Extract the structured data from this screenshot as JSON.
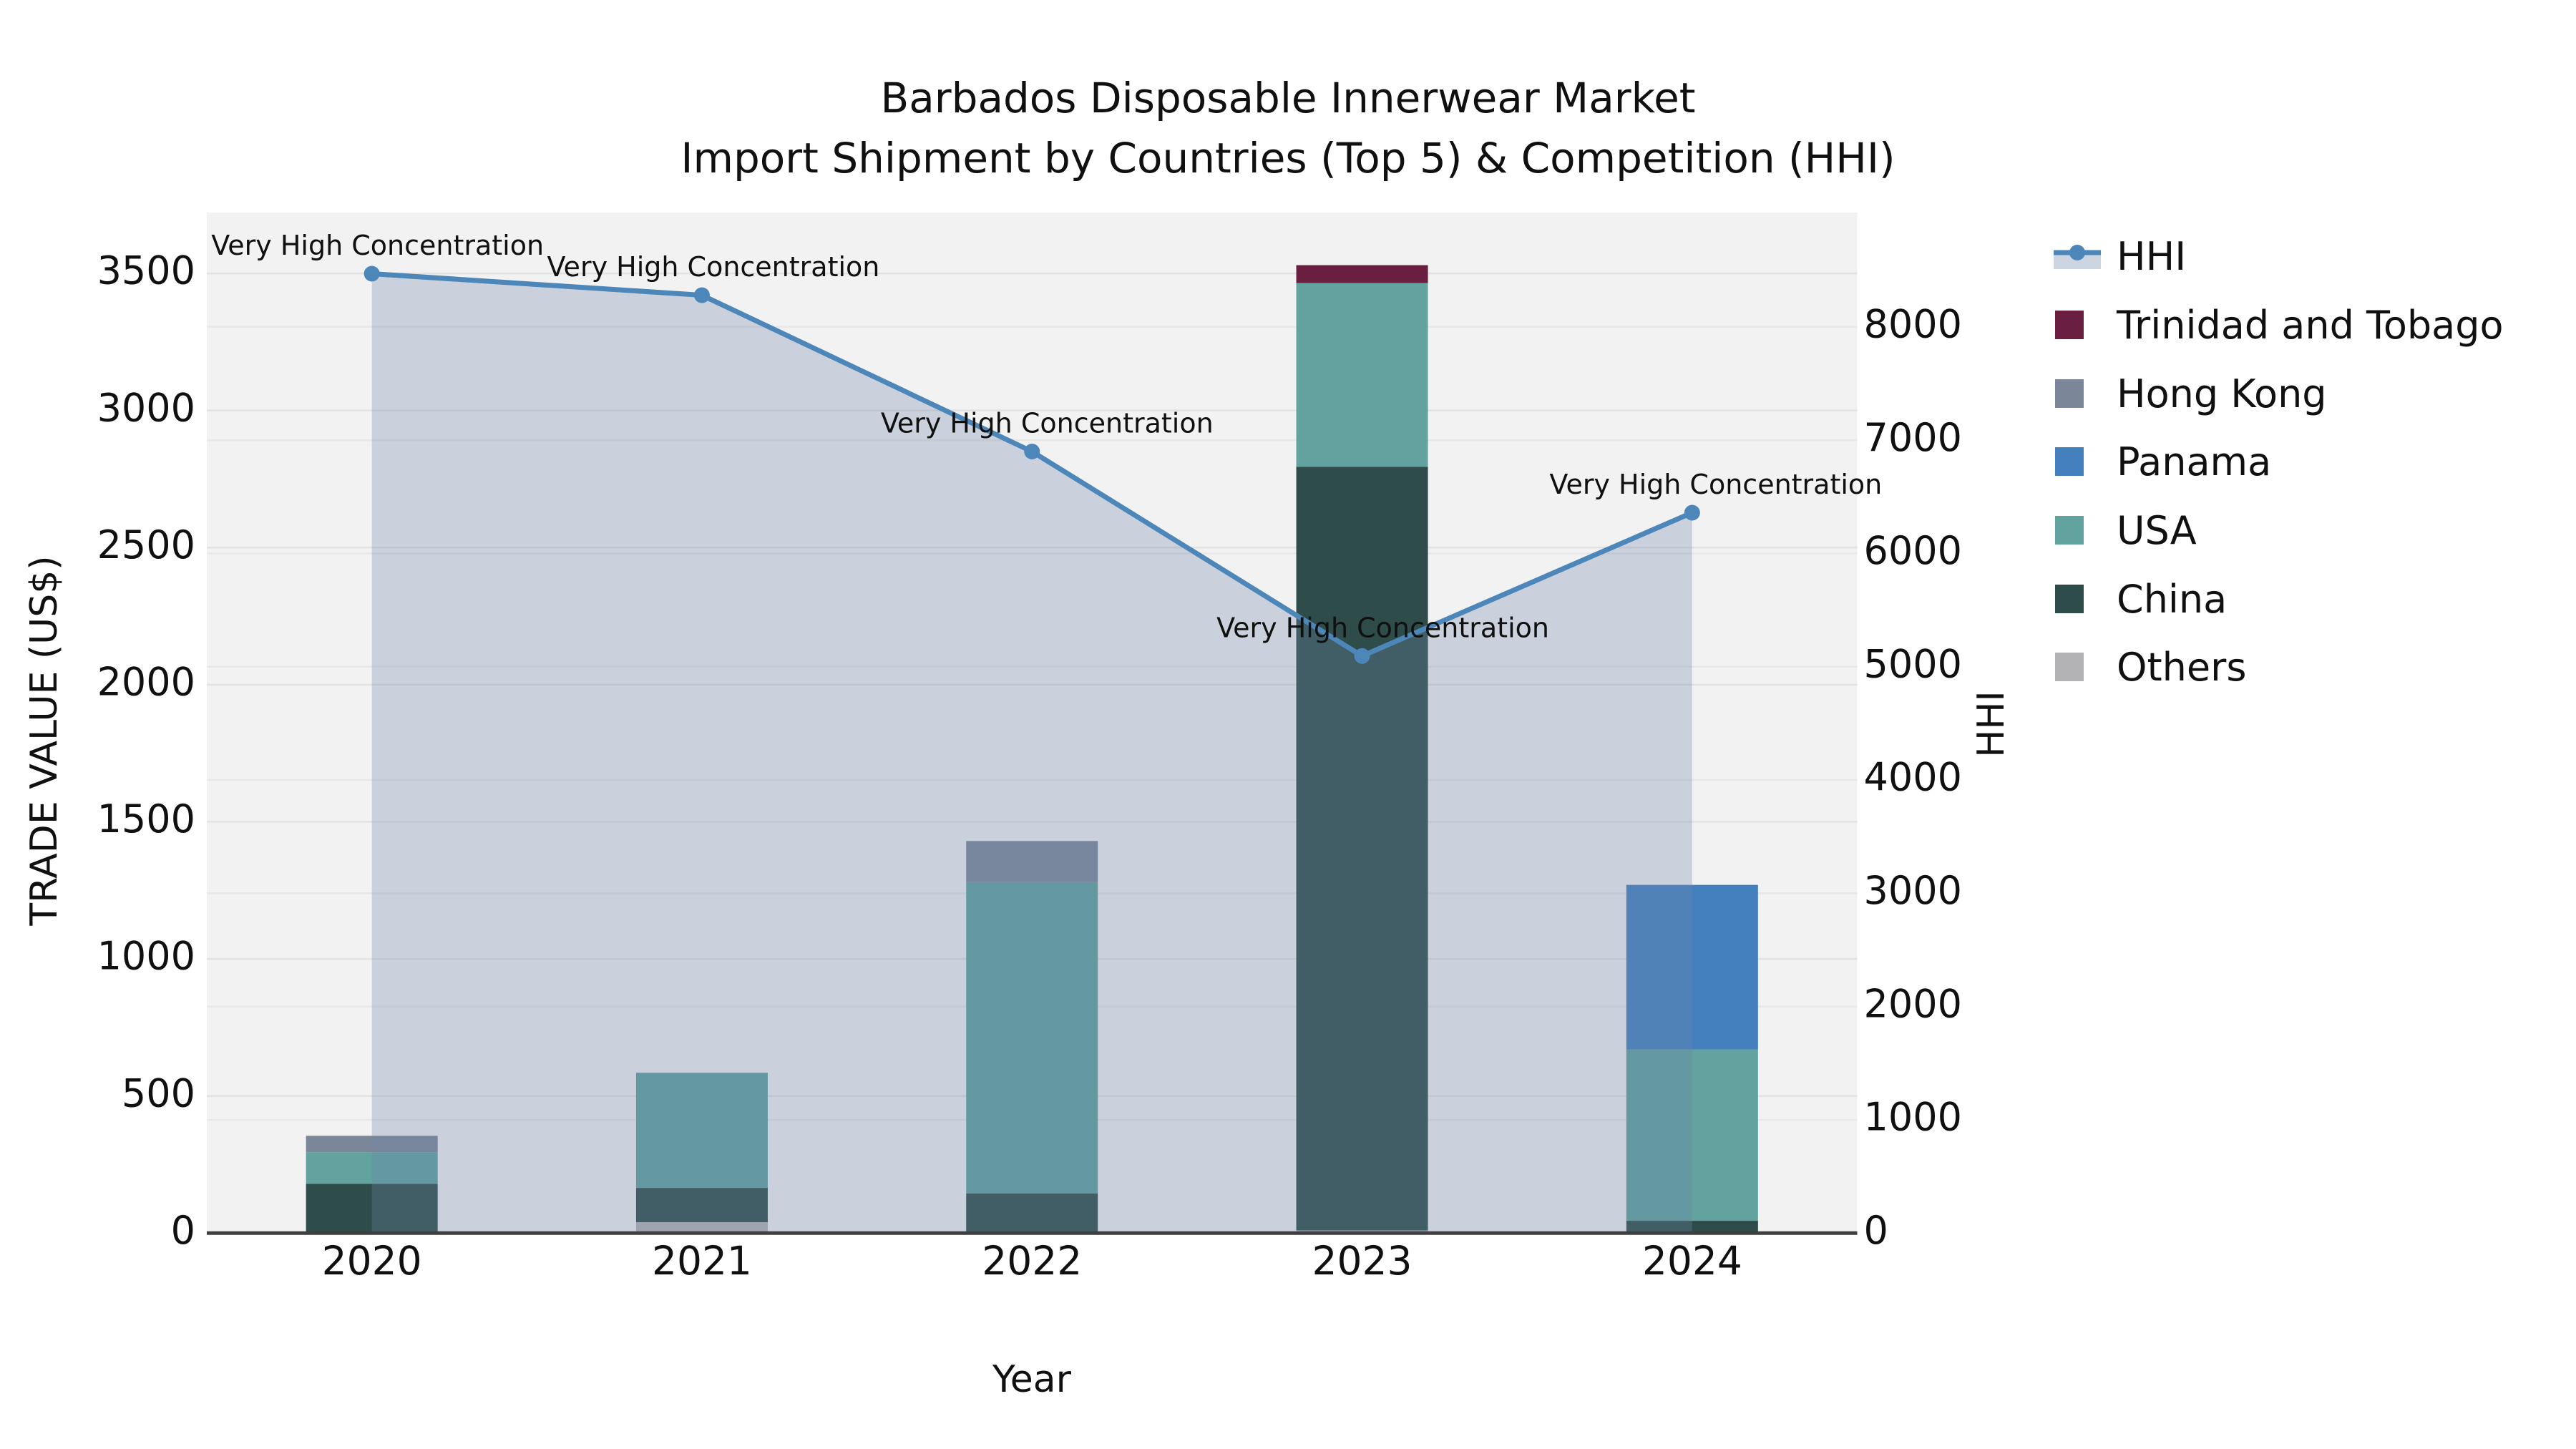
{
  "title": {
    "line1": "Barbados Disposable Innerwear Market",
    "line2": "Import Shipment by Countries (Top 5) & Competition (HHI)"
  },
  "colors": {
    "plot_background": "#f2f2f2",
    "grid_left": "#e2e2e2",
    "grid_right": "#e7e7e7",
    "axis_line": "#3f3f3f",
    "hhi_line": "#4d86b8",
    "hhi_area_fill": "rgba(109,132,169,0.30)",
    "hhi_legend_band": "#ccd5e0",
    "text": "#101010"
  },
  "chart_data": {
    "type": "combo-stacked-bar-line",
    "title": "Barbados Disposable Innerwear Market — Import Shipment by Countries (Top 5) & Competition (HHI)",
    "categories": [
      "2020",
      "2021",
      "2022",
      "2023",
      "2024"
    ],
    "bar_series": [
      {
        "name": "Others",
        "color": "#b3b3b5",
        "values": [
          0,
          40,
          0,
          10,
          0
        ]
      },
      {
        "name": "China",
        "color": "#2e4c49",
        "values": [
          180,
          125,
          145,
          2785,
          45
        ]
      },
      {
        "name": "USA",
        "color": "#62a29f",
        "values": [
          115,
          420,
          1135,
          670,
          625
        ]
      },
      {
        "name": "Panama",
        "color": "#4480bd",
        "values": [
          0,
          0,
          0,
          0,
          600
        ]
      },
      {
        "name": "Hong Kong",
        "color": "#7b8799",
        "values": [
          60,
          0,
          150,
          0,
          0
        ]
      },
      {
        "name": "Trinidad and Tobago",
        "color": "#6a1f41",
        "values": [
          0,
          0,
          0,
          65,
          0
        ]
      }
    ],
    "line_series": {
      "name": "HHI",
      "color": "#4d86b8",
      "values": [
        8470,
        8280,
        6900,
        5095,
        6360
      ],
      "area": true
    },
    "annotations": [
      {
        "category": "2020",
        "text": "Very High Concentration"
      },
      {
        "category": "2021",
        "text": "Very High Concentration"
      },
      {
        "category": "2022",
        "text": "Very High Concentration"
      },
      {
        "category": "2023",
        "text": "Very High Concentration"
      },
      {
        "category": "2024",
        "text": "Very High Concentration"
      }
    ],
    "axes": {
      "x": {
        "title": "Year"
      },
      "left": {
        "title": "TRADE VALUE (US$)",
        "min": 0,
        "max": 3722,
        "tick_step": 500,
        "ticks": [
          0,
          500,
          1000,
          1500,
          2000,
          2500,
          3000,
          3500
        ]
      },
      "right": {
        "title": "HHI",
        "min": 0,
        "max": 9010,
        "tick_step": 1000,
        "ticks": [
          0,
          1000,
          2000,
          3000,
          4000,
          5000,
          6000,
          7000,
          8000
        ]
      }
    },
    "legend_position": "right",
    "grid": true,
    "legend": [
      {
        "label": "HHI",
        "glyph": "line-marker-band"
      },
      {
        "label": "Trinidad and Tobago",
        "glyph": "square",
        "color": "#6a1f41"
      },
      {
        "label": "Hong Kong",
        "glyph": "square",
        "color": "#7b8799"
      },
      {
        "label": "Panama",
        "glyph": "square",
        "color": "#4480bd"
      },
      {
        "label": "USA",
        "glyph": "square",
        "color": "#62a29f"
      },
      {
        "label": "China",
        "glyph": "square",
        "color": "#2e4c49"
      },
      {
        "label": "Others",
        "glyph": "square",
        "color": "#b3b3b5"
      }
    ]
  }
}
